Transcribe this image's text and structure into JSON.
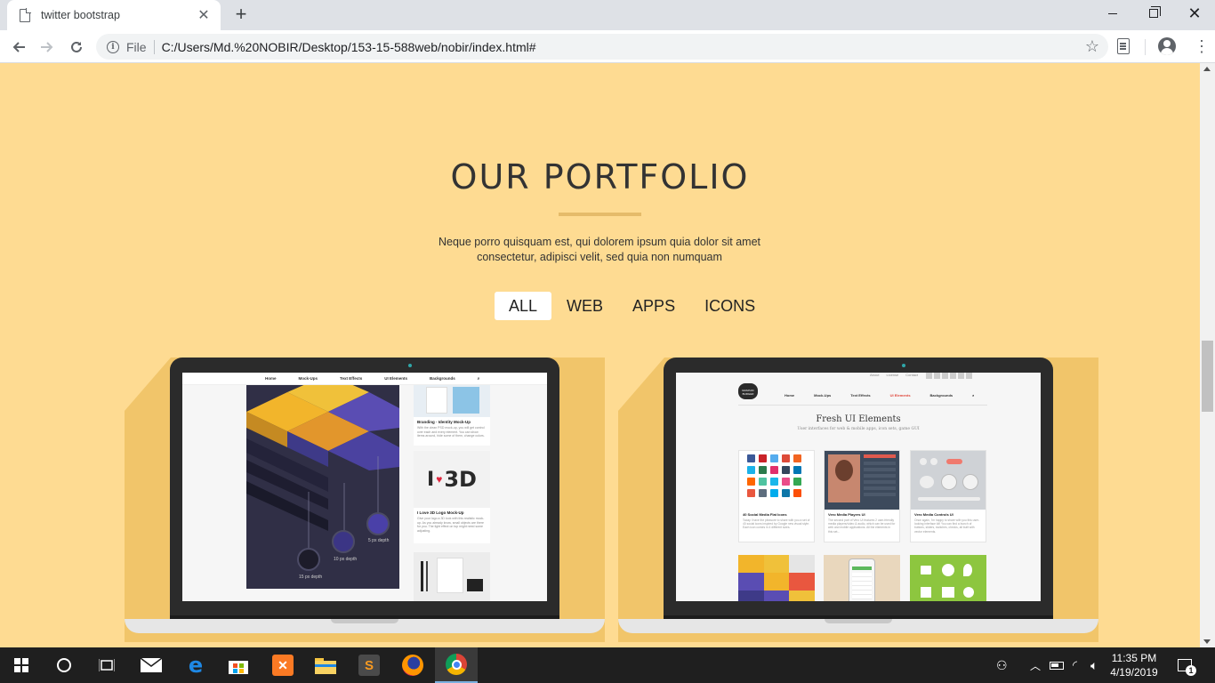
{
  "browser": {
    "tab_title": "twitter bootstrap",
    "tab_close": "✕",
    "new_tab": "+",
    "omnibox_scheme": "File",
    "url": "C:/Users/Md.%20NOBIR/Desktop/153-15-588web/nobir/index.html#"
  },
  "page": {
    "title": "OUR PORTFOLIO",
    "description": "Neque porro quisquam est, qui dolorem ipsum quia dolor sit amet consectetur, adipisci velit, sed quia non numquam",
    "filters": [
      "ALL",
      "WEB",
      "APPS",
      "ICONS"
    ],
    "active_filter": "ALL",
    "background_color": "#fedb92",
    "accent_color": "#e5bb6a"
  },
  "portfolio": {
    "left": {
      "nav": [
        "Home",
        "Mock-Ups",
        "Text Effects",
        "UI Elements",
        "Backgrounds"
      ],
      "cards": [
        {
          "title": "Branding · Identity Mock-Up",
          "text": "With the clean PSD mock-up, you will get control over each and every element. You can show items around, hide some of them, change colors."
        },
        {
          "title": "I Love 3D Logo Mock-Up",
          "text": "Give your logo a 3D look with this realistic mock-up. As you already know, small objects are there for you. The light effect on top might need some adjusting."
        }
      ],
      "depth_labels": [
        "5 px depth",
        "10 px depth",
        "15 px depth"
      ]
    },
    "right": {
      "top_links": [
        "About",
        "License",
        "Contact"
      ],
      "logo_text": "GRAPHIC BURGER",
      "nav": [
        "Home",
        "Mock-Ups",
        "Text Effects",
        "UI Elements",
        "Backgrounds"
      ],
      "heading": "Fresh UI Elements",
      "subheading": "User interfaces for web & mobile apps, icon sets, game GUI",
      "cards": [
        {
          "title": "40 Social Media Flat Icons",
          "text": "Today I have the pleasure to share with you a set of 40 social icons inspired by Google new visual style. Each icon comes in 4 different sizes."
        },
        {
          "title": "Vero Media Players UI",
          "text": "The second part of Vero UI features 2 user-friendly media players/video & audio, which can be used for web and mobile applications. All the elements in this set..."
        },
        {
          "title": "Vero Media Controls UI",
          "text": "Once again, I'm happy to share with you this user-looking interface kit! You can find a bunch of buttons, sliders, switches, checks, all built with vector elements."
        }
      ]
    }
  },
  "taskbar": {
    "time": "11:35 PM",
    "date": "4/19/2019"
  }
}
